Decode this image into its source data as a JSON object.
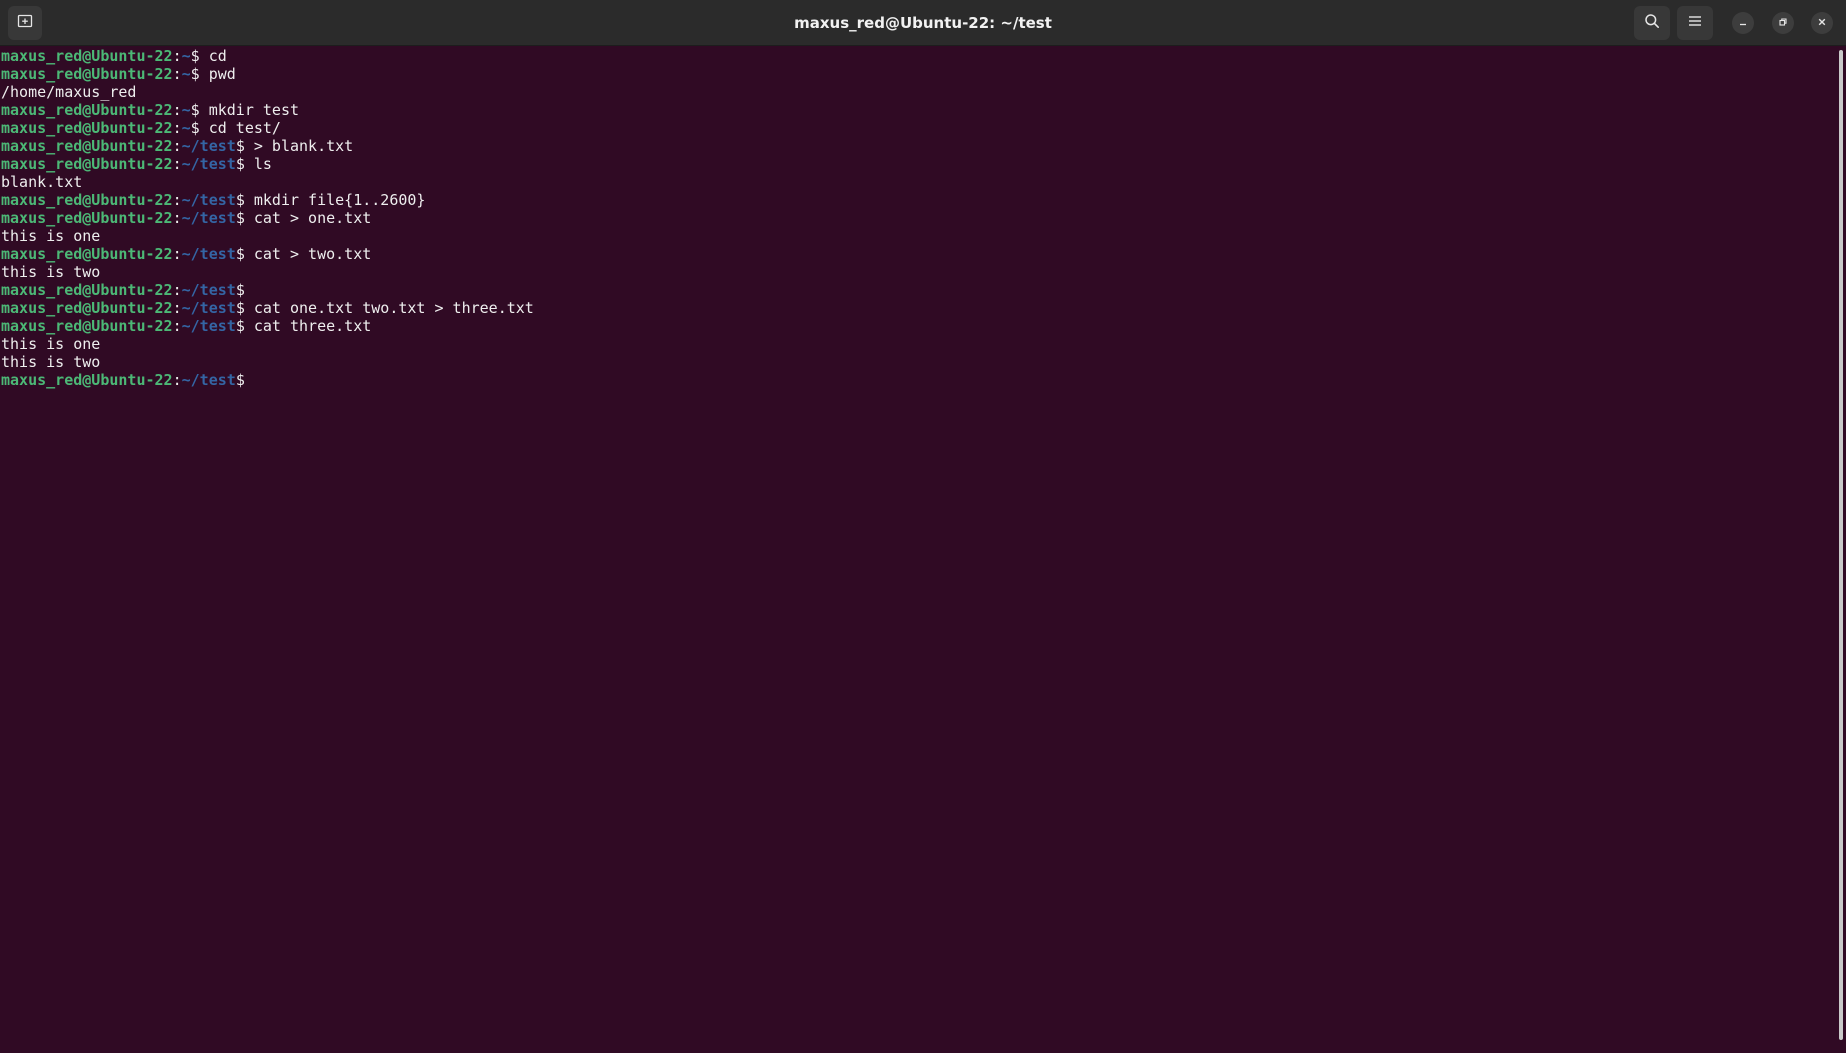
{
  "window": {
    "title": "maxus_red@Ubuntu-22: ~/test"
  },
  "titlebar": {
    "new_tab_icon": "new-tab-icon",
    "search_icon": "search-icon",
    "menu_icon": "hamburger-menu-icon",
    "minimize_icon": "minimize-icon",
    "maximize_icon": "restore-icon",
    "close_icon": "close-icon"
  },
  "colors": {
    "background": "#300a24",
    "prompt_user": "#4cb876",
    "prompt_path": "#3465a4",
    "text": "#eeeeee"
  },
  "terminal": {
    "lines": [
      {
        "type": "prompt",
        "user": "maxus_red@Ubuntu-22",
        "path": "~",
        "command": "cd"
      },
      {
        "type": "prompt",
        "user": "maxus_red@Ubuntu-22",
        "path": "~",
        "command": "pwd"
      },
      {
        "type": "output",
        "text": "/home/maxus_red"
      },
      {
        "type": "prompt",
        "user": "maxus_red@Ubuntu-22",
        "path": "~",
        "command": "mkdir test"
      },
      {
        "type": "prompt",
        "user": "maxus_red@Ubuntu-22",
        "path": "~",
        "command": "cd test/"
      },
      {
        "type": "prompt",
        "user": "maxus_red@Ubuntu-22",
        "path": "~/test",
        "command": "> blank.txt"
      },
      {
        "type": "prompt",
        "user": "maxus_red@Ubuntu-22",
        "path": "~/test",
        "command": "ls"
      },
      {
        "type": "output",
        "text": "blank.txt"
      },
      {
        "type": "prompt",
        "user": "maxus_red@Ubuntu-22",
        "path": "~/test",
        "command": "mkdir file{1..2600}"
      },
      {
        "type": "prompt",
        "user": "maxus_red@Ubuntu-22",
        "path": "~/test",
        "command": "cat > one.txt"
      },
      {
        "type": "output",
        "text": "this is one"
      },
      {
        "type": "prompt",
        "user": "maxus_red@Ubuntu-22",
        "path": "~/test",
        "command": "cat > two.txt"
      },
      {
        "type": "output",
        "text": "this is two"
      },
      {
        "type": "prompt",
        "user": "maxus_red@Ubuntu-22",
        "path": "~/test",
        "command": ""
      },
      {
        "type": "prompt",
        "user": "maxus_red@Ubuntu-22",
        "path": "~/test",
        "command": "cat one.txt two.txt > three.txt"
      },
      {
        "type": "prompt",
        "user": "maxus_red@Ubuntu-22",
        "path": "~/test",
        "command": "cat three.txt"
      },
      {
        "type": "output",
        "text": "this is one"
      },
      {
        "type": "output",
        "text": "this is two"
      },
      {
        "type": "prompt",
        "user": "maxus_red@Ubuntu-22",
        "path": "~/test",
        "command": ""
      }
    ]
  }
}
